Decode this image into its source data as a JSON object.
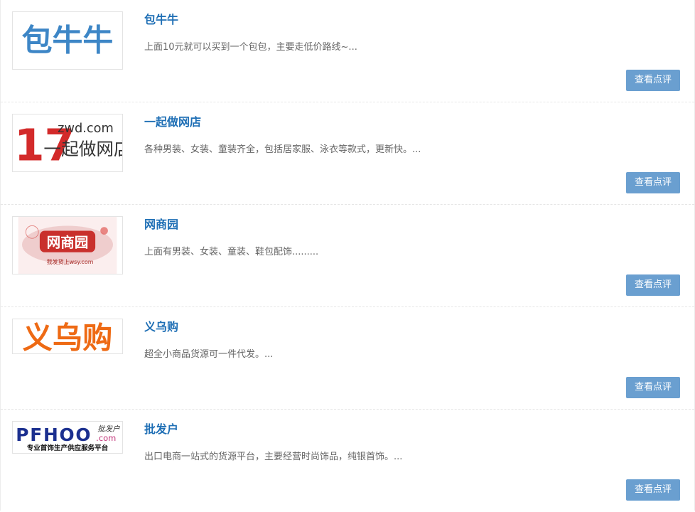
{
  "items": [
    {
      "title": "包牛牛",
      "desc": "上面10元就可以买到一个包包，主要走低价路线~...",
      "button": "查看点评",
      "logo": {
        "name": "baoniuniu-logo",
        "text": "包牛牛",
        "color": "#3d86c6"
      }
    },
    {
      "title": "一起做网店",
      "desc": "各种男装、女装、童装齐全，包括居家服、泳衣等款式，更新快。...",
      "button": "查看点评",
      "logo": {
        "name": "17zwd-logo",
        "num": "17",
        "domain": "zwd.com",
        "text": "一起做网店",
        "color": "#d32a2a"
      }
    },
    {
      "title": "网商园",
      "desc": "上面有男装、女装、童装、鞋包配饰.........",
      "button": "查看点评",
      "logo": {
        "name": "wangshangyuan-logo",
        "text": "网商园",
        "sub": "我发货上wsy.com",
        "color": "#c9302c"
      }
    },
    {
      "title": "义乌购",
      "desc": "超全小商品货源可一件代发。...",
      "button": "查看点评",
      "logo": {
        "name": "yiwugou-logo",
        "text": "义乌购",
        "color": "#ee6a14"
      }
    },
    {
      "title": "批发户",
      "desc": "出口电商一站式的货源平台，主要经营时尚饰品，纯银首饰。...",
      "button": "查看点评",
      "logo": {
        "name": "pfhoo-logo",
        "brand": "PFHOO",
        "cn": "批发户",
        "domain": ".com",
        "tagline": "专业首饰生产供应服务平台",
        "color": "#1b2f8f",
        "accent": "#c2367a"
      }
    }
  ]
}
